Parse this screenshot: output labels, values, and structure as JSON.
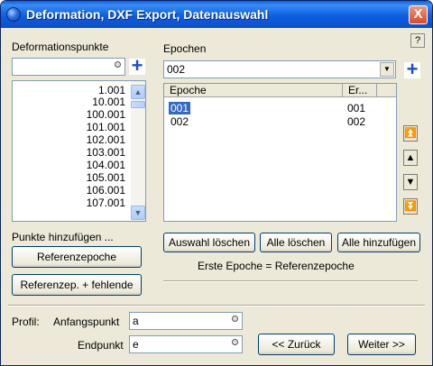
{
  "window": {
    "title": "Deformation, DXF Export, Datenauswahl",
    "close_label": "X",
    "help_label": "?"
  },
  "left": {
    "header": "Deformationspunkte",
    "search_value": "",
    "plus_label": "+",
    "points": [
      "1.001",
      "10.001",
      "100.001",
      "101.001",
      "102.001",
      "103.001",
      "104.001",
      "105.001",
      "106.001",
      "107.001"
    ],
    "add_label": "Punkte hinzufügen ...",
    "ref_epoch_button": "Referenzepoche",
    "ref_missing_button": "Referenzep. + fehlende"
  },
  "right": {
    "header": "Epochen",
    "combo_value": "002",
    "plus_label": "+",
    "columns": [
      "Epoche",
      "Er..."
    ],
    "rows": [
      {
        "epoche": "001",
        "er": "001",
        "selected": true
      },
      {
        "epoche": "002",
        "er": "002",
        "selected": false
      }
    ],
    "clear_selection_button": "Auswahl löschen",
    "clear_all_button": "Alle löschen",
    "add_all_button": "Alle hinzufügen",
    "first_epoch_note": "Erste Epoche = Referenzepoche"
  },
  "nav": {
    "first": "⏫",
    "up": "▲",
    "down": "▼",
    "last": "⏬"
  },
  "bottom": {
    "profil_label": "Profil:",
    "start_label": "Anfangspunkt",
    "start_value": "a",
    "end_label": "Endpunkt",
    "end_value": "e",
    "back_button": "<< Zurück",
    "next_button": "Weiter >>"
  }
}
